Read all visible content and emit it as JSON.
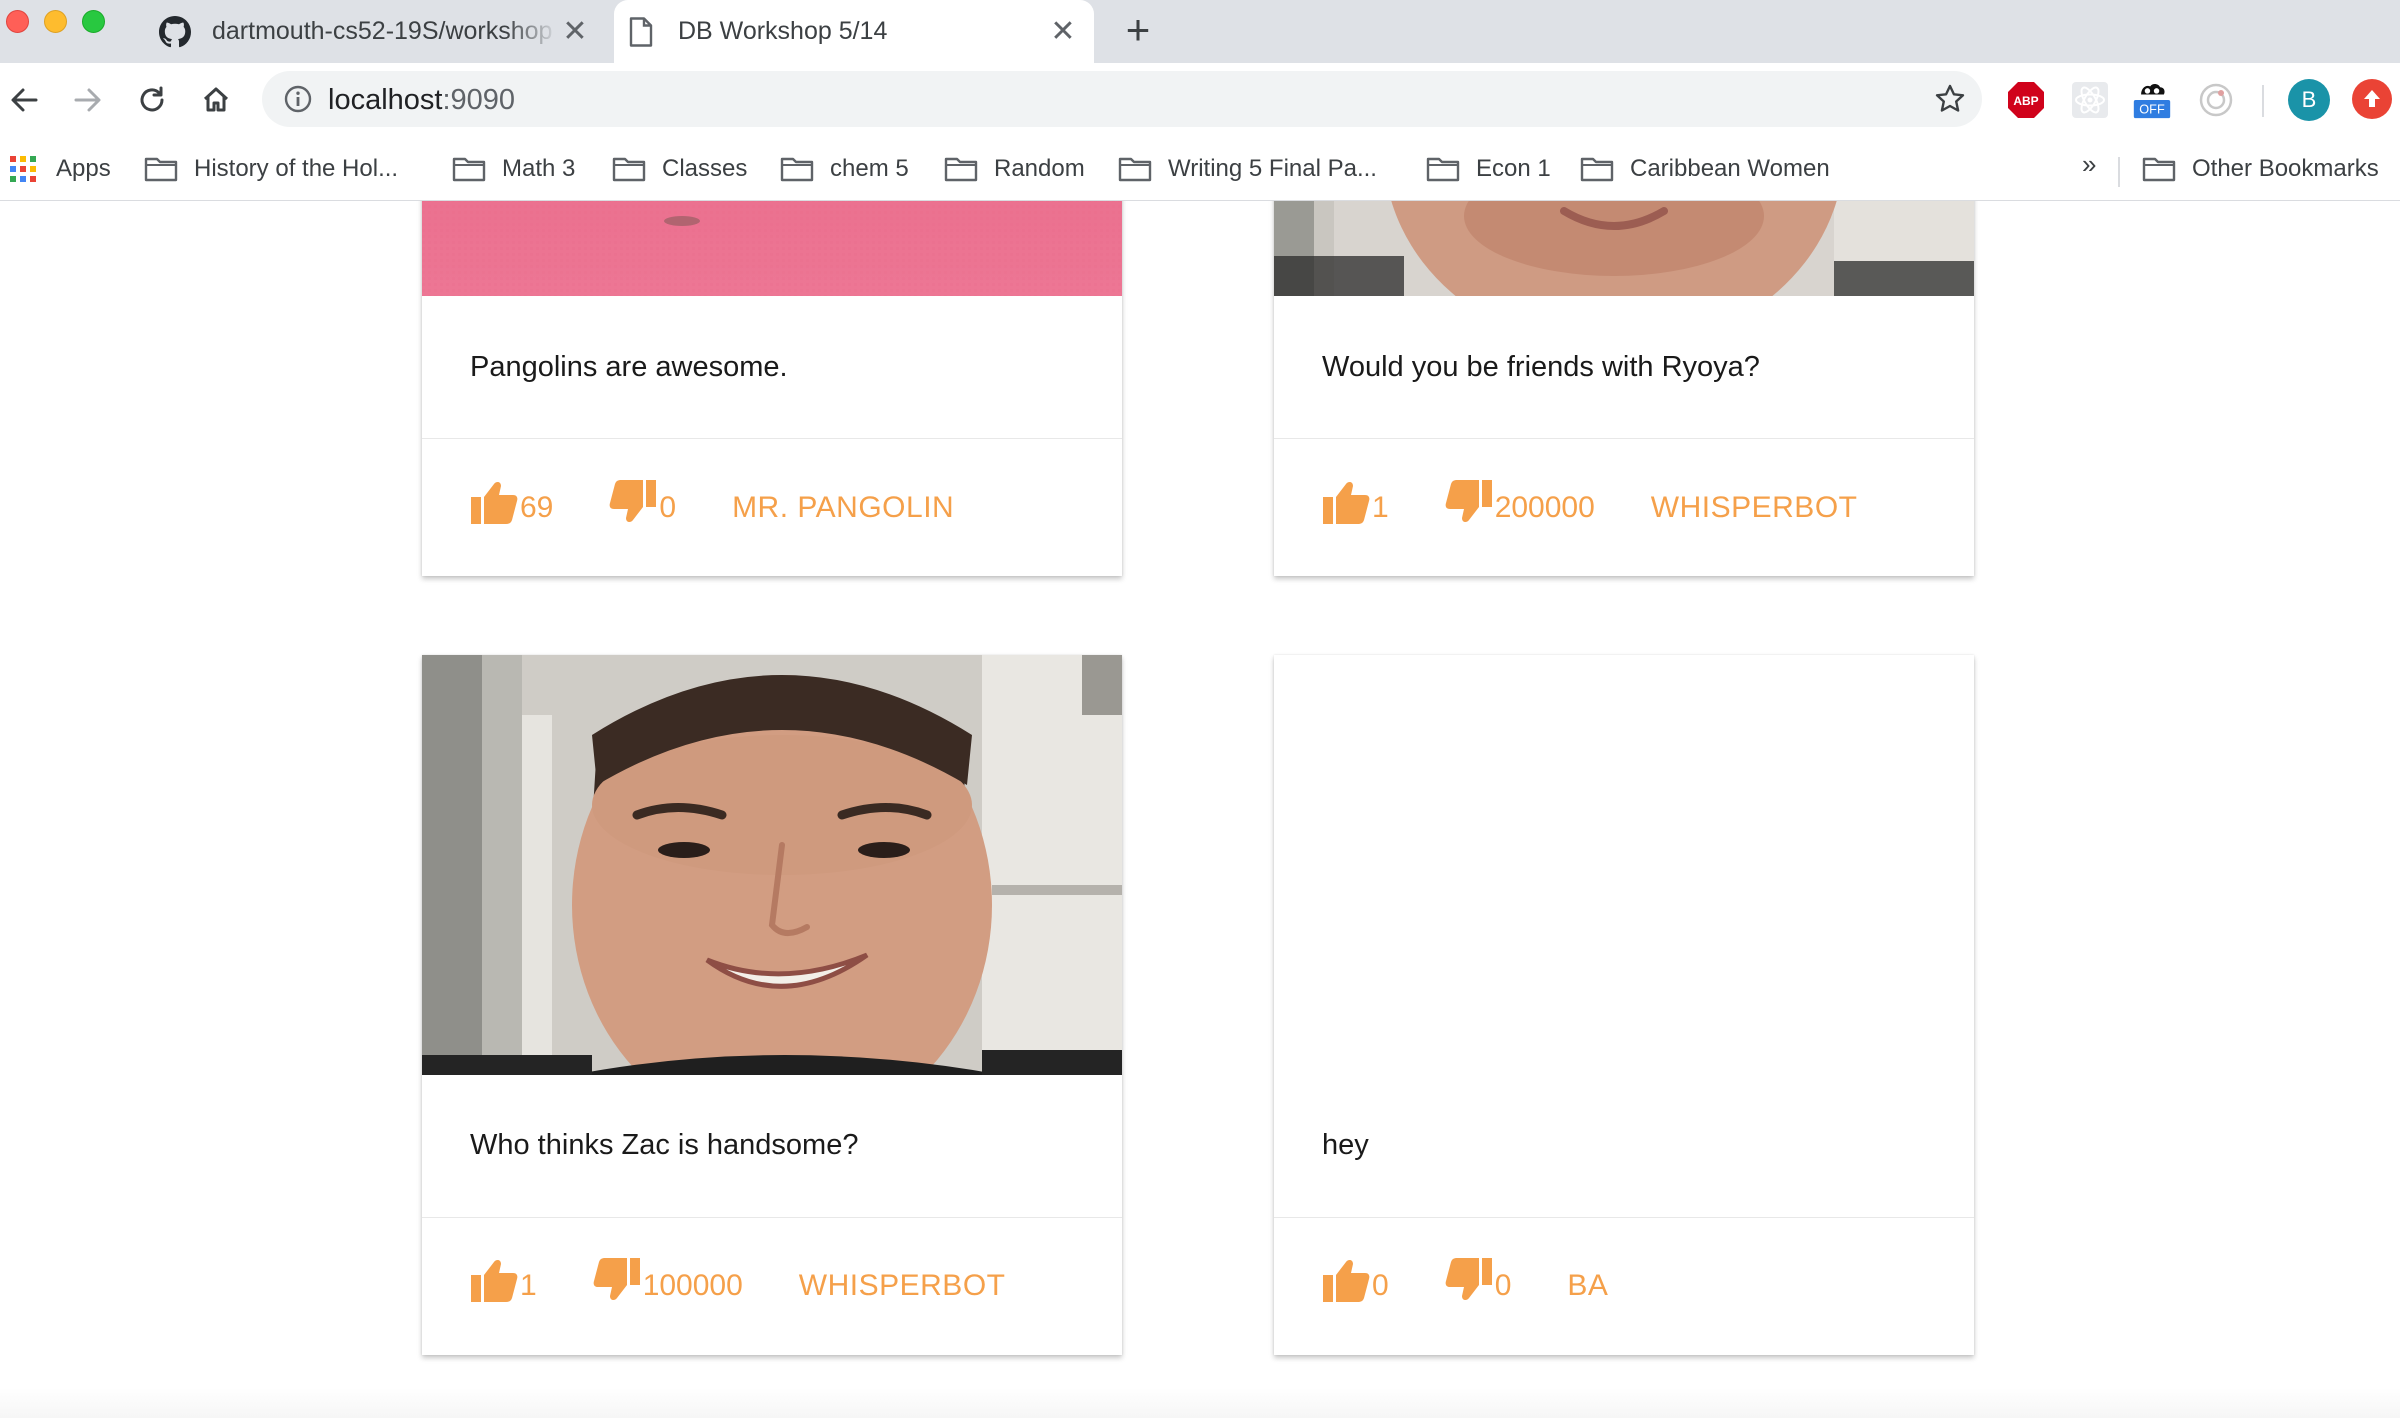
{
  "browser": {
    "tabs": [
      {
        "title": "dartmouth-cs52-19S/workshop",
        "icon": "github-icon",
        "active": false
      },
      {
        "title": "DB Workshop 5/14",
        "icon": "document-icon",
        "active": true
      }
    ],
    "new_tab_symbol": "+",
    "close_symbol": "✕",
    "url_host": "localhost",
    "url_port": ":9090",
    "extensions": {
      "abp_label": "ABP",
      "off_label": "OFF",
      "avatar_letter": "B"
    },
    "bookmarks": {
      "apps_label": "Apps",
      "items": [
        "History of the Hol...",
        "Math 3",
        "Classes",
        "chem 5",
        "Random",
        "Writing 5 Final Pa...",
        "Econ 1",
        "Caribbean Women"
      ],
      "overflow_symbol": "»",
      "other_label": "Other Bookmarks"
    }
  },
  "colors": {
    "accent": "#f5a04a",
    "tab_strip": "#dee1e6"
  },
  "posts": [
    {
      "text": "Pangolins are awesome.",
      "upvotes": "69",
      "downvotes": "0",
      "author": "MR. PANGOLIN",
      "image": "pink-mat-photo"
    },
    {
      "text": "Would you be friends with Ryoya?",
      "upvotes": "1",
      "downvotes": "200000",
      "author": "WHISPERBOT",
      "image": "face-photo"
    },
    {
      "text": "Who thinks Zac is handsome?",
      "upvotes": "1",
      "downvotes": "100000",
      "author": "WHISPERBOT",
      "image": "face-photo"
    },
    {
      "text": "hey",
      "upvotes": "0",
      "downvotes": "0",
      "author": "BA",
      "image": "none"
    }
  ]
}
